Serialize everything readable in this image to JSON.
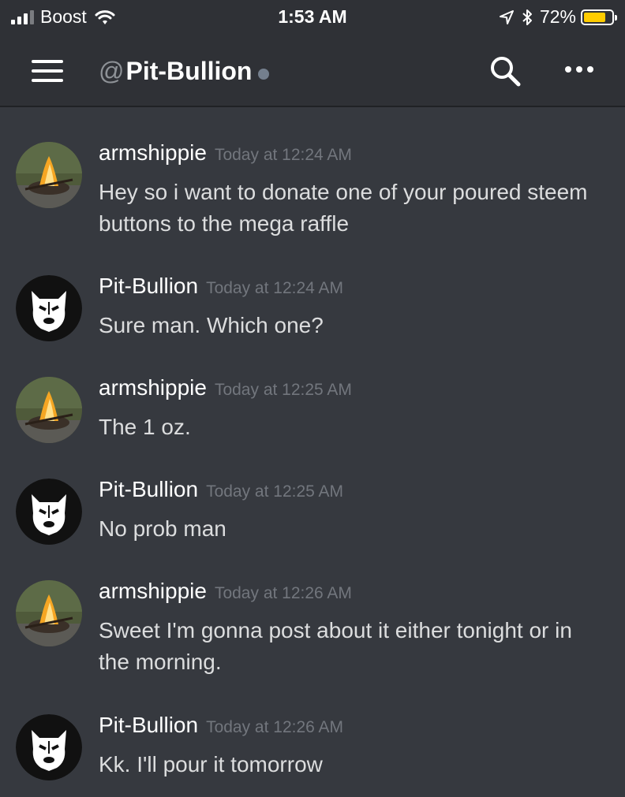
{
  "status_bar": {
    "carrier": "Boost",
    "time": "1:53 AM",
    "battery_percent": "72%"
  },
  "header": {
    "at_sign": "@",
    "channel_name": "Pit-Bullion",
    "menu_icon": "hamburger-menu-icon",
    "search_icon": "search-icon",
    "more_icon": "more-options-icon"
  },
  "messages": [
    {
      "author": "armshippie",
      "timestamp": "Today at 12:24 AM",
      "text": "Hey so i want to donate one of your poured steem buttons to the mega raffle",
      "avatar": "campfire"
    },
    {
      "author": "Pit-Bullion",
      "timestamp": "Today at 12:24 AM",
      "text": "Sure man. Which one?",
      "avatar": "pitbull"
    },
    {
      "author": "armshippie",
      "timestamp": "Today at 12:25 AM",
      "text": "The 1 oz.",
      "avatar": "campfire"
    },
    {
      "author": "Pit-Bullion",
      "timestamp": "Today at 12:25 AM",
      "text": "No prob man",
      "avatar": "pitbull"
    },
    {
      "author": "armshippie",
      "timestamp": "Today at 12:26 AM",
      "text": "Sweet I'm gonna post about it either tonight or in the morning.",
      "avatar": "campfire"
    },
    {
      "author": "Pit-Bullion",
      "timestamp": "Today at 12:26 AM",
      "text": "Kk. I'll pour it tomorrow",
      "avatar": "pitbull"
    }
  ],
  "colors": {
    "background": "#36393f",
    "header": "#2f3136",
    "author": "#ffffff",
    "timestamp": "#72767d",
    "text": "#dcddde",
    "battery": "#ffcc00"
  }
}
